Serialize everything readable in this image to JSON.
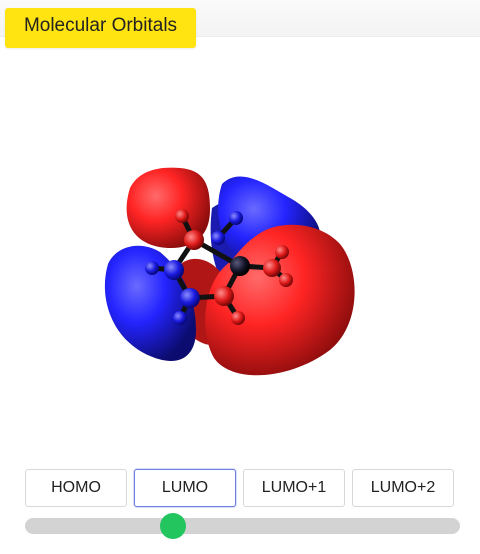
{
  "header": {
    "title": "Molecular Orbitals"
  },
  "orbitals": {
    "buttons": [
      {
        "label": "HOMO"
      },
      {
        "label": "LUMO"
      },
      {
        "label": "LUMO+1"
      },
      {
        "label": "LUMO+2"
      }
    ],
    "selected_index": 1
  },
  "slider": {
    "value_fraction": 0.34,
    "thumb_color": "#22c55e"
  },
  "colors": {
    "title_badge": "#ffe411",
    "positive_lobe": "#ff2a2a",
    "negative_lobe": "#2a2aff",
    "active_border": "#6d7fe0"
  }
}
